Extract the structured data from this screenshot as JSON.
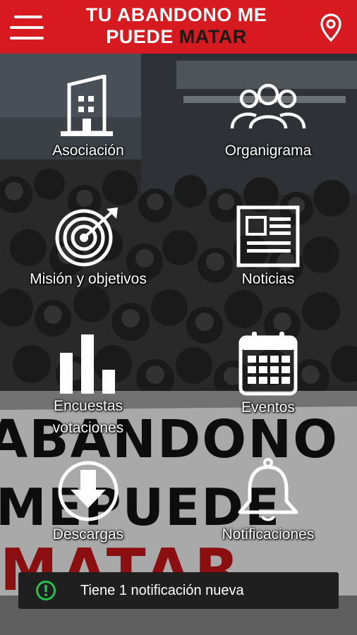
{
  "header": {
    "title_line1": "TU ABANDONO ME",
    "title_line2_a": "PUEDE ",
    "title_line2_b": "MATAR",
    "menu_icon": "hamburger-menu-icon",
    "location_icon": "location-pin-icon",
    "brand_color": "#d71920"
  },
  "menu": [
    {
      "label": "Asociación",
      "icon": "building-icon"
    },
    {
      "label": "Organigrama",
      "icon": "people-group-icon"
    },
    {
      "label": "Misión y objetivos",
      "icon": "target-icon"
    },
    {
      "label": "Noticias",
      "icon": "newspaper-icon"
    },
    {
      "label_line1": "Encuestas",
      "label_line2": "votaciones",
      "icon": "bar-chart-icon"
    },
    {
      "label": "Eventos",
      "icon": "calendar-icon"
    },
    {
      "label": "Descargas",
      "icon": "download-icon"
    },
    {
      "label": "Notificaciones",
      "icon": "bell-icon"
    }
  ],
  "snackbar": {
    "text": "Tiene 1 notificación nueva",
    "icon": "alert-circle-icon",
    "icon_color": "#27c24c"
  }
}
